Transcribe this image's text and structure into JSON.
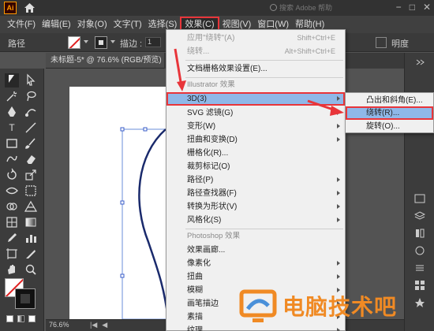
{
  "titlebar": {
    "app_logo": "Ai",
    "search_placeholder": "搜索 Adobe 帮助",
    "window_buttons": [
      "−",
      "□",
      "✕"
    ]
  },
  "menubar": {
    "items": [
      "文件(F)",
      "编辑(E)",
      "对象(O)",
      "文字(T)",
      "选择(S)",
      "效果(C)",
      "视图(V)",
      "窗口(W)",
      "帮助(H)"
    ],
    "active_index": 5
  },
  "control_bar": {
    "path_label": "路径",
    "stroke_label": "描边 :",
    "stroke_value": "1",
    "opacity_label": "明度"
  },
  "document": {
    "tab_title": "未标题-5* @ 76.6% (RGB/预览)",
    "zoom": "76.6%"
  },
  "effect_menu": {
    "items": [
      {
        "label": "应用\"绕转\"(A)",
        "shortcut": "Shift+Ctrl+E",
        "disabled": true
      },
      {
        "label": "绕转...",
        "shortcut": "Alt+Shift+Ctrl+E",
        "disabled": true
      },
      {
        "label": "文档栅格效果设置(E)..."
      },
      {
        "header": "Illustrator 效果"
      },
      {
        "label": "3D(3)",
        "submenu": true,
        "highlighted": true
      },
      {
        "label": "SVG 滤镜(G)",
        "submenu": true
      },
      {
        "label": "变形(W)",
        "submenu": true
      },
      {
        "label": "扭曲和变换(D)",
        "submenu": true
      },
      {
        "label": "栅格化(R)..."
      },
      {
        "label": "裁剪标记(O)"
      },
      {
        "label": "路径(P)",
        "submenu": true
      },
      {
        "label": "路径查找器(F)",
        "submenu": true
      },
      {
        "label": "转换为形状(V)",
        "submenu": true
      },
      {
        "label": "风格化(S)",
        "submenu": true
      },
      {
        "header": "Photoshop 效果"
      },
      {
        "label": "效果画廊..."
      },
      {
        "label": "像素化",
        "submenu": true
      },
      {
        "label": "扭曲",
        "submenu": true
      },
      {
        "label": "模糊",
        "submenu": true
      },
      {
        "label": "画笔描边",
        "submenu": true
      },
      {
        "label": "素描",
        "submenu": true
      },
      {
        "label": "纹理",
        "submenu": true
      }
    ]
  },
  "submenu_3d": {
    "items": [
      {
        "label": "凸出和斜角(E)..."
      },
      {
        "label": "绕转(R)...",
        "highlighted": true
      },
      {
        "label": "旋转(O)..."
      }
    ]
  },
  "watermark": {
    "text": "电脑技术吧"
  },
  "colors": {
    "highlight": "#8fb8e8",
    "annotation": "#e8353a",
    "selection_path": "#1a2a6c"
  }
}
